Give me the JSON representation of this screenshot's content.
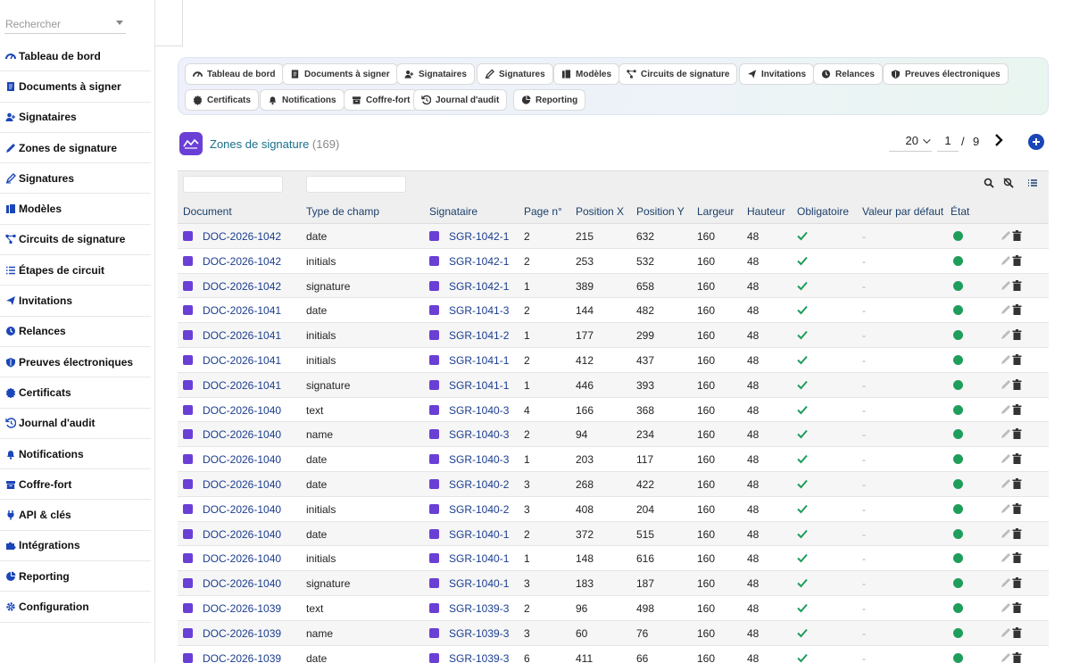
{
  "sidebar": {
    "search_placeholder": "Rechercher",
    "items": [
      {
        "label": "Tableau de bord",
        "icon": "dashboard-icon"
      },
      {
        "label": "Documents à signer",
        "icon": "document-icon"
      },
      {
        "label": "Signataires",
        "icon": "users-icon"
      },
      {
        "label": "Zones de signature",
        "icon": "pen-icon"
      },
      {
        "label": "Signatures",
        "icon": "signature-icon"
      },
      {
        "label": "Modèles",
        "icon": "template-icon"
      },
      {
        "label": "Circuits de signature",
        "icon": "workflow-icon"
      },
      {
        "label": "Étapes de circuit",
        "icon": "list-icon"
      },
      {
        "label": "Invitations",
        "icon": "send-icon"
      },
      {
        "label": "Relances",
        "icon": "clock-icon"
      },
      {
        "label": "Preuves électroniques",
        "icon": "shield-icon"
      },
      {
        "label": "Certificats",
        "icon": "certificate-icon"
      },
      {
        "label": "Journal d'audit",
        "icon": "history-icon"
      },
      {
        "label": "Notifications",
        "icon": "bell-icon"
      },
      {
        "label": "Coffre-fort",
        "icon": "vault-icon"
      },
      {
        "label": "API & clés",
        "icon": "plug-icon"
      },
      {
        "label": "Intégrations",
        "icon": "puzzle-icon"
      },
      {
        "label": "Reporting",
        "icon": "chart-icon"
      },
      {
        "label": "Configuration",
        "icon": "gear-icon"
      }
    ]
  },
  "chips": [
    {
      "label": "Tableau de bord",
      "icon": "dashboard-icon"
    },
    {
      "label": "Documents à signer",
      "icon": "document-icon"
    },
    {
      "label": "Signataires",
      "icon": "users-icon"
    },
    {
      "label": "Signatures",
      "icon": "signature-icon"
    },
    {
      "label": "Modèles",
      "icon": "template-icon"
    },
    {
      "label": "Circuits de signature",
      "icon": "workflow-icon"
    },
    {
      "label": "Invitations",
      "icon": "send-icon"
    },
    {
      "label": "Relances",
      "icon": "clock-icon"
    },
    {
      "label": "Preuves électroniques",
      "icon": "shield-icon"
    },
    {
      "label": "Certificats",
      "icon": "certificate-icon"
    },
    {
      "label": "Notifications",
      "icon": "bell-icon"
    },
    {
      "label": "Coffre-fort",
      "icon": "vault-icon"
    },
    {
      "label": "Journal d'audit",
      "icon": "history-icon"
    },
    {
      "label": "Reporting",
      "icon": "chart-icon"
    }
  ],
  "header": {
    "title": "Zones de signature",
    "count": "(169)",
    "page_size": "20",
    "page": "1",
    "page_sep": "/",
    "total_pages": "9"
  },
  "table": {
    "columns": [
      "Document",
      "Type de champ",
      "Signataire",
      "Page n°",
      "Position X",
      "Position Y",
      "Largeur",
      "Hauteur",
      "Obligatoire",
      "Valeur par défaut",
      "État"
    ],
    "rows": [
      [
        "DOC-2026-1042",
        "date",
        "SGR-1042-1",
        "2",
        "215",
        "632",
        "160",
        "48",
        "-"
      ],
      [
        "DOC-2026-1042",
        "initials",
        "SGR-1042-1",
        "2",
        "253",
        "532",
        "160",
        "48",
        "-"
      ],
      [
        "DOC-2026-1042",
        "signature",
        "SGR-1042-1",
        "1",
        "389",
        "658",
        "160",
        "48",
        "-"
      ],
      [
        "DOC-2026-1041",
        "date",
        "SGR-1041-3",
        "2",
        "144",
        "482",
        "160",
        "48",
        "-"
      ],
      [
        "DOC-2026-1041",
        "initials",
        "SGR-1041-2",
        "1",
        "177",
        "299",
        "160",
        "48",
        "-"
      ],
      [
        "DOC-2026-1041",
        "initials",
        "SGR-1041-1",
        "2",
        "412",
        "437",
        "160",
        "48",
        "-"
      ],
      [
        "DOC-2026-1041",
        "signature",
        "SGR-1041-1",
        "1",
        "446",
        "393",
        "160",
        "48",
        "-"
      ],
      [
        "DOC-2026-1040",
        "text",
        "SGR-1040-3",
        "4",
        "166",
        "368",
        "160",
        "48",
        "-"
      ],
      [
        "DOC-2026-1040",
        "name",
        "SGR-1040-3",
        "2",
        "94",
        "234",
        "160",
        "48",
        "-"
      ],
      [
        "DOC-2026-1040",
        "date",
        "SGR-1040-3",
        "1",
        "203",
        "117",
        "160",
        "48",
        "-"
      ],
      [
        "DOC-2026-1040",
        "date",
        "SGR-1040-2",
        "3",
        "268",
        "422",
        "160",
        "48",
        "-"
      ],
      [
        "DOC-2026-1040",
        "initials",
        "SGR-1040-2",
        "3",
        "408",
        "204",
        "160",
        "48",
        "-"
      ],
      [
        "DOC-2026-1040",
        "date",
        "SGR-1040-1",
        "2",
        "372",
        "515",
        "160",
        "48",
        "-"
      ],
      [
        "DOC-2026-1040",
        "initials",
        "SGR-1040-1",
        "1",
        "148",
        "616",
        "160",
        "48",
        "-"
      ],
      [
        "DOC-2026-1040",
        "signature",
        "SGR-1040-1",
        "3",
        "183",
        "187",
        "160",
        "48",
        "-"
      ],
      [
        "DOC-2026-1039",
        "text",
        "SGR-1039-3",
        "2",
        "96",
        "498",
        "160",
        "48",
        "-"
      ],
      [
        "DOC-2026-1039",
        "name",
        "SGR-1039-3",
        "3",
        "60",
        "76",
        "160",
        "48",
        "-"
      ],
      [
        "DOC-2026-1039",
        "date",
        "SGR-1039-3",
        "6",
        "411",
        "66",
        "160",
        "48",
        "-"
      ]
    ]
  },
  "colors": {
    "accent": "#6a3fd6",
    "link": "#1a3d8f",
    "status_active": "#1f9d5b",
    "check": "#1f9d5b",
    "add_button": "#1b46b8"
  }
}
